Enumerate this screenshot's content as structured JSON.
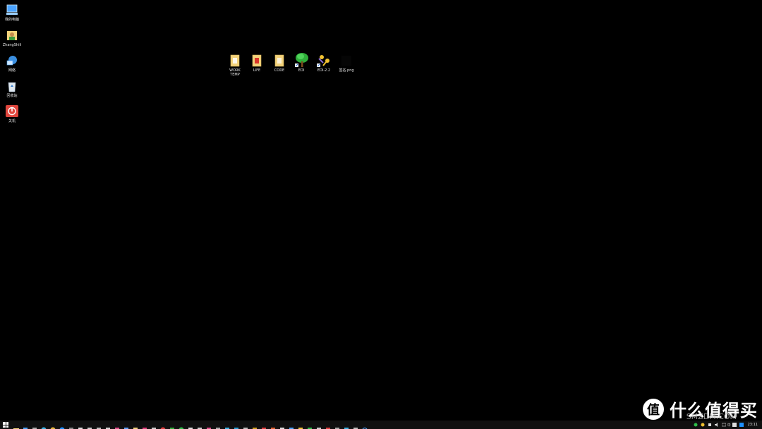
{
  "desktop": {
    "left_icons": [
      {
        "label": "我的电脑",
        "icon": "computer-icon"
      },
      {
        "label": "ZhangShili",
        "icon": "user-folder-icon"
      },
      {
        "label": "网络",
        "icon": "network-icon"
      },
      {
        "label": "回收站",
        "icon": "recycle-bin-icon"
      },
      {
        "label": "关机",
        "icon": "shutdown-icon"
      }
    ],
    "center_icons": [
      {
        "label": "WORK\nTEMP",
        "icon": "folder-icon"
      },
      {
        "label": "LIFE",
        "icon": "folder-icon"
      },
      {
        "label": "CODE",
        "icon": "folder-icon"
      },
      {
        "label": "EDI",
        "icon": "tree-icon"
      },
      {
        "label": "EDI-2.2",
        "icon": "keys-icon"
      },
      {
        "label": "签名.png",
        "icon": "image-icon"
      }
    ]
  },
  "taskbar": {
    "clock": "23:11",
    "ime": "中",
    "accent": "#1e90ff"
  },
  "watermark": {
    "logo_char": "值",
    "text": "什么值得买",
    "sub": "SMZDM.COM"
  },
  "colors": {
    "background": "#000000",
    "label": "#e8e8e8",
    "folder": "#f3d27a"
  }
}
